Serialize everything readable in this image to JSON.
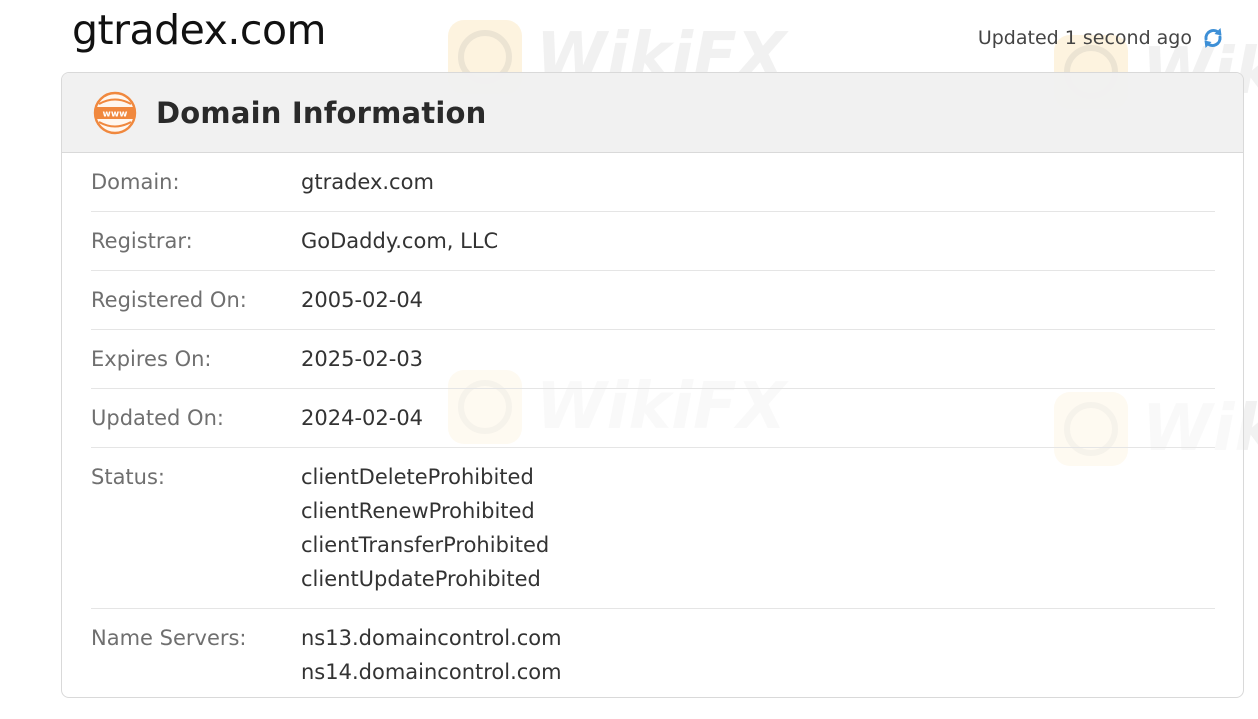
{
  "page": {
    "title": "gtradex.com",
    "updated_text": "Updated 1 second ago"
  },
  "card": {
    "title": "Domain Information",
    "icon": "www-globe-icon"
  },
  "fields": {
    "domain": {
      "label": "Domain:",
      "value": "gtradex.com"
    },
    "registrar": {
      "label": "Registrar:",
      "value": "GoDaddy.com, LLC"
    },
    "registered_on": {
      "label": "Registered On:",
      "value": "2005-02-04"
    },
    "expires_on": {
      "label": "Expires On:",
      "value": "2025-02-03"
    },
    "updated_on": {
      "label": "Updated On:",
      "value": "2024-02-04"
    },
    "status": {
      "label": "Status:",
      "values": [
        "clientDeleteProhibited",
        "clientRenewProhibited",
        "clientTransferProhibited",
        "clientUpdateProhibited"
      ]
    },
    "name_servers": {
      "label": "Name Servers:",
      "values": [
        "ns13.domaincontrol.com",
        "ns14.domaincontrol.com"
      ]
    }
  },
  "watermark": {
    "text": "WikiFX"
  },
  "colors": {
    "accent_orange": "#f0883e",
    "refresh_blue": "#3d8fd6",
    "header_bg": "#f0f0f0",
    "label_gray": "#6f6f6f"
  }
}
